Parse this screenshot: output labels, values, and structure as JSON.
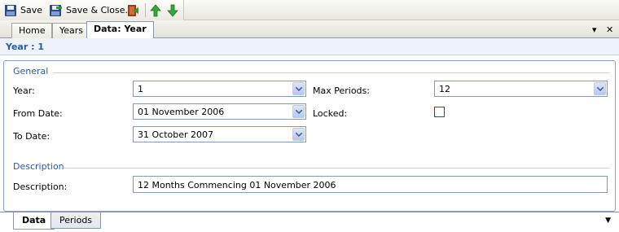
{
  "toolbar": {
    "save_label": "Save",
    "save_close_label": "Save & Close..."
  },
  "tabs": [
    "Home",
    "Years",
    "Data: Year"
  ],
  "header": {
    "title": "Year : 1"
  },
  "general": {
    "heading": "General",
    "year_label": "Year:",
    "year_value": "1",
    "from_label": "From Date:",
    "from_value": "01 November 2006",
    "to_label": "To Date:",
    "to_value": "31 October 2007",
    "max_periods_label": "Max Periods:",
    "max_periods_value": "12",
    "locked_label": "Locked:",
    "locked_checked": false
  },
  "description": {
    "heading": "Description",
    "label": "Description:",
    "value": "12 Months Commencing 01 November 2006"
  },
  "bottom_tabs": [
    "Data",
    "Periods"
  ]
}
